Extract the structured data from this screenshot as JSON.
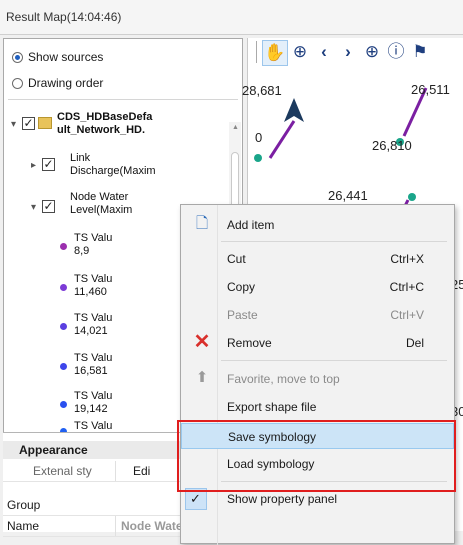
{
  "window": {
    "title": "Result Map(14:04:46)"
  },
  "layer_panel": {
    "show_sources": "Show sources",
    "drawing_order": "Drawing order",
    "root_node": [
      "CDS_HDBaseDefa",
      "ult_Network_HD."
    ],
    "link_node": [
      "Link",
      "Discharge(Maxim"
    ],
    "node_node": [
      "Node Water",
      "Level(Maxim"
    ],
    "ts_items": [
      {
        "lines": [
          "TS Valu",
          "8,9"
        ],
        "color": "#9b2fae"
      },
      {
        "lines": [
          "TS Valu",
          "11,460"
        ],
        "color": "#7c3bd6"
      },
      {
        "lines": [
          "TS Valu",
          "14,021"
        ],
        "color": "#5a3fe0"
      },
      {
        "lines": [
          "TS Valu",
          "16,581"
        ],
        "color": "#3d45ea"
      },
      {
        "lines": [
          "TS Valu",
          "19,142"
        ],
        "color": "#2a50ef"
      },
      {
        "lines": [
          "TS Valu",
          ""
        ],
        "color": "#2060f2"
      }
    ]
  },
  "property_panel": {
    "section": "Appearance",
    "row1_label": "Extenal sty",
    "row1_value": "Edi",
    "row2_label": "Group",
    "row3_label": "Name",
    "row3_value": "Node Water ..."
  },
  "map": {
    "labels": [
      "28,681",
      "26,511",
      "26,810",
      "26,441",
      "0",
      "25",
      "30"
    ],
    "toolbar_icons": [
      "pan-icon",
      "zoom-in-icon",
      "back-icon",
      "forward-icon",
      "globe-icon",
      "info-icon",
      "flag-icon"
    ]
  },
  "context_menu": {
    "add_item": "Add item",
    "cut": "Cut",
    "cut_shortcut": "Ctrl+X",
    "copy": "Copy",
    "copy_shortcut": "Ctrl+C",
    "paste": "Paste",
    "paste_shortcut": "Ctrl+V",
    "remove": "Remove",
    "remove_shortcut": "Del",
    "favorite": "Favorite, move to top",
    "export": "Export shape file",
    "save_symbology": "Save symbology",
    "load_symbology": "Load symbology",
    "show_property_panel": "Show property panel"
  },
  "colors": {
    "highlight": "#cce4f7",
    "red_outline": "#e01e1e",
    "map_line": "#7b1fa2",
    "map_node": "#1aa58a"
  }
}
